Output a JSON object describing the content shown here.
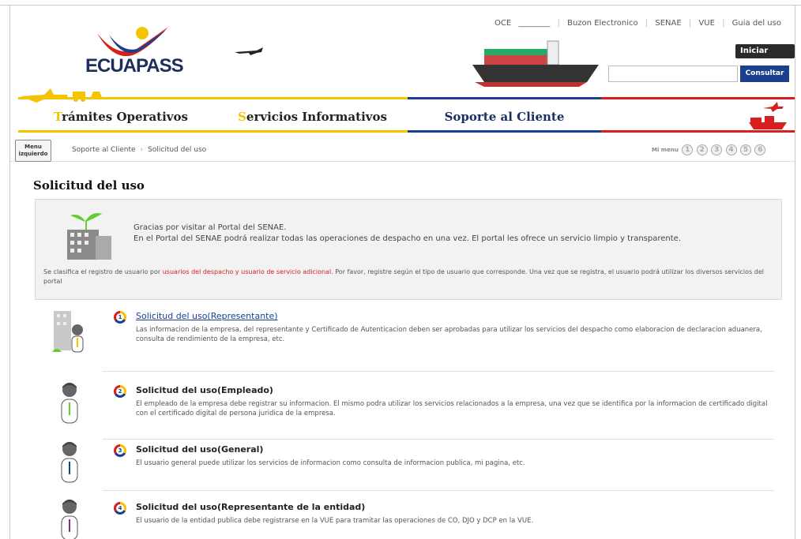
{
  "app": {
    "logo": "ECUAPASS"
  },
  "top_links": [
    "OCE",
    "Buzon Electronico",
    "SENAE",
    "VUE",
    "Guia del uso"
  ],
  "oce_blank": "________",
  "login_label": "Iniciar sesión",
  "search": {
    "placeholder": "",
    "button_label": "Consultar"
  },
  "nav": {
    "items": [
      {
        "first_letter": "T",
        "rest": "rámites Operativos"
      },
      {
        "first_letter": "S",
        "rest": "ervicios Informativos"
      },
      {
        "label": "Soporte al Cliente"
      }
    ]
  },
  "crumbbar": {
    "menu_label": "Menu izquierdo",
    "crumbs": [
      "Soporte al Cliente",
      "Solicitud del uso"
    ],
    "mimenu_label": "Mi menu",
    "shortcuts": [
      "1",
      "2",
      "3",
      "4",
      "5",
      "6"
    ]
  },
  "page_title": "Solicitud del uso",
  "info": {
    "line1": "Gracias por visitar al Portal del SENAE.",
    "line2": "En el Portal del SENAE podrá realizar todas las operaciones de despacho en una vez. El portal les ofrece un servicio limpio y transparente.",
    "note_before": "Se clasifica el registro de usuario por ",
    "note_highlight": "usuarios del despacho y usuario de servicio adicional",
    "note_after": ". Por favor, registre según el tipo de usuario que corresponde. Una vez que se registra, el usuario podrá utilizar los diversos servicios del portal"
  },
  "items": [
    {
      "num": "1",
      "title": "Solicitud del uso(Representante)",
      "desc": "Las informacion de la empresa, del representante y Certificado de Autenticacion deben ser aprobadas para utilizar los servicios del despacho como elaboracion de declaracion aduanera, consulta de rendimiento de la empresa, etc."
    },
    {
      "num": "2",
      "title": "Solicitud del uso(Empleado)",
      "desc": "El empleado de la empresa debe registrar su informacion. El mismo podra utilizar los servicios relacionados a la empresa, una vez que se identifica por la informacion de certificado digital con el certificado digital de persona juridica de la empresa."
    },
    {
      "num": "3",
      "title": "Solicitud del uso(General)",
      "desc": "El usuario general puede utilizar los servicios de informacion como consulta de informacion publica, mi pagina, etc."
    },
    {
      "num": "4",
      "title": "Solicitud del uso(Representante de la entidad)",
      "desc": "El usuario de la entidad publica debe registrarse en la VUE para tramitar las operaciones de CO, DJO y DCP en la VUE."
    }
  ],
  "colors": {
    "yellow": "#f5c400",
    "blue": "#1b3f8c",
    "red": "#d62020"
  }
}
